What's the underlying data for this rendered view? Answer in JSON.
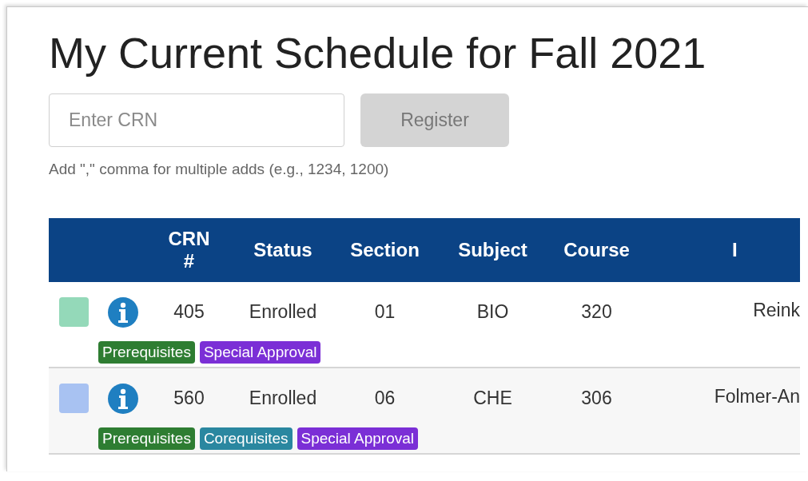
{
  "title": "My Current Schedule for Fall 2021",
  "crn_field": {
    "placeholder": "Enter CRN"
  },
  "register_button": {
    "label": "Register",
    "disabled": true
  },
  "hint": "Add \",\" comma for multiple adds (e.g., 1234, 1200)",
  "table": {
    "columns": [
      "",
      "",
      "CRN #",
      "Status",
      "Section",
      "Subject",
      "Course",
      "I"
    ],
    "rows": [
      {
        "color": "#94d9b9",
        "crn": "405",
        "status": "Enrolled",
        "section": "01",
        "subject": "BIO",
        "course": "320",
        "instructor": "Reink",
        "tags": [
          {
            "label": "Prerequisites",
            "color": "#2e7d32"
          },
          {
            "label": "Special Approval",
            "color": "#7b2fd6"
          }
        ]
      },
      {
        "color": "#a8c2f2",
        "crn": "560",
        "status": "Enrolled",
        "section": "06",
        "subject": "CHE",
        "course": "306",
        "instructor": "Folmer-An",
        "tags": [
          {
            "label": "Prerequisites",
            "color": "#2e7d32"
          },
          {
            "label": "Corequisites",
            "color": "#2a87a0"
          },
          {
            "label": "Special Approval",
            "color": "#7b2fd6"
          }
        ]
      }
    ]
  }
}
